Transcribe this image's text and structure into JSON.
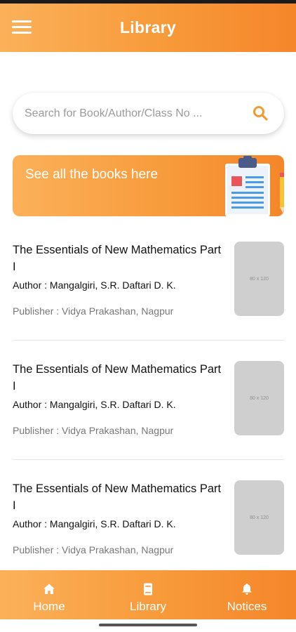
{
  "header": {
    "title": "Library",
    "menu_icon": "hamburger-menu-icon"
  },
  "search": {
    "placeholder": "Search for Book/Author/Class No ...",
    "value": "",
    "icon": "search-icon"
  },
  "banner": {
    "text": "See all the books here",
    "illustration": "clipboard-pencil-illustration"
  },
  "books": [
    {
      "title": "The Essentials of New Mathematics Part I",
      "author": "Author : Mangalgiri, S.R. Daftari D. K.",
      "publisher": "Publisher : Vidya Prakashan, Nagpur",
      "thumb_label": "80 x 120"
    },
    {
      "title": "The Essentials of New Mathematics Part I",
      "author": "Author : Mangalgiri, S.R. Daftari D. K.",
      "publisher": "Publisher : Vidya Prakashan, Nagpur",
      "thumb_label": "80 x 120"
    },
    {
      "title": "The Essentials of New Mathematics Part I",
      "author": "Author : Mangalgiri, S.R. Daftari D. K.",
      "publisher": "Publisher : Vidya Prakashan, Nagpur",
      "thumb_label": "80 x 120"
    }
  ],
  "bottom_nav": {
    "items": [
      {
        "label": "Home",
        "icon": "home-icon"
      },
      {
        "label": "Library",
        "icon": "book-icon"
      },
      {
        "label": "Notices",
        "icon": "bell-icon"
      }
    ]
  },
  "colors": {
    "accent_light": "#fbb15a",
    "accent": "#f79a3a",
    "accent_dark": "#f5862a"
  }
}
